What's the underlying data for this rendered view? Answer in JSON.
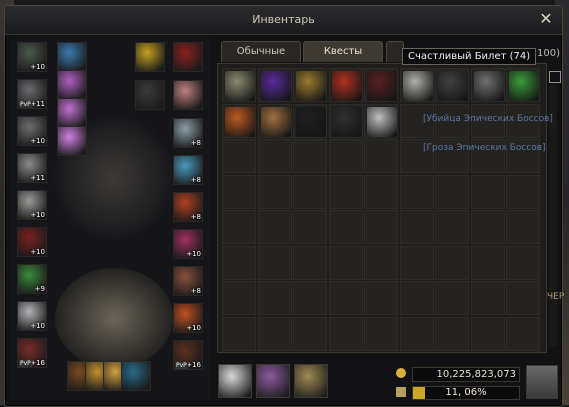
{
  "window": {
    "title": "Инвентарь",
    "close_glyph": "✕"
  },
  "tabs": [
    {
      "label": "Обычные",
      "active": false
    },
    {
      "label": "Квесты",
      "active": true
    }
  ],
  "tooltip": {
    "text": "Счастливый Билет (74)"
  },
  "capacity_partial": "100)",
  "background_texts": [
    "[Убийца Эпических Боссов]",
    "[Гроза Эпических Боссов]",
    "ЧЕР"
  ],
  "equipment_left": [
    {
      "name": "helmet",
      "enc": "+10",
      "color": "#4a5a4a"
    },
    {
      "name": "armor-top",
      "enc": "+11",
      "pvp": "PvP",
      "color": "#6a6a70"
    },
    {
      "name": "gloves",
      "enc": "+10",
      "color": "#6e6e72"
    },
    {
      "name": "legs",
      "enc": "+11",
      "color": "#8a8a88"
    },
    {
      "name": "boots",
      "enc": "+10",
      "color": "#9a9a96"
    },
    {
      "name": "cloak",
      "enc": "+10",
      "color": "#7a2020"
    },
    {
      "name": "shirt",
      "enc": "+9",
      "color": "#3a8a3a"
    },
    {
      "name": "ring-left",
      "enc": "+10",
      "color": "#b0b4b8"
    },
    {
      "name": "weapon",
      "enc": "+16",
      "pvp": "PvP",
      "color": "#7a2a2a"
    }
  ],
  "equipment_center": [
    {
      "name": "necklace",
      "color": "#3a7ab0"
    },
    {
      "name": "talisman-1",
      "color": "#b060c0"
    },
    {
      "name": "talisman-2",
      "color": "#c070d0"
    },
    {
      "name": "talisman-3",
      "color": "#d080e0"
    }
  ],
  "equipment_right": [
    {
      "name": "gold-item",
      "color": "#c8a020"
    },
    {
      "name": "hair-accessory",
      "color": "#8a2020"
    },
    {
      "name": "costume",
      "color": "#3a3a3a"
    },
    {
      "name": "gem",
      "color": "#c08080"
    },
    {
      "name": "sword",
      "enc": "+8",
      "color": "#8aa0a8"
    },
    {
      "name": "staff",
      "enc": "+8",
      "color": "#4a9ac0"
    },
    {
      "name": "amulet",
      "enc": "+8",
      "color": "#b04020"
    },
    {
      "name": "ring-right",
      "enc": "+10",
      "color": "#a03060"
    },
    {
      "name": "earring",
      "enc": "+8",
      "color": "#8a5040"
    },
    {
      "name": "pet-icon",
      "enc": "+10",
      "color": "#c05020"
    },
    {
      "name": "shield",
      "enc": "+16",
      "pvp": "PvP",
      "color": "#5a3020"
    }
  ],
  "bottom_slots": [
    {
      "name": "belt",
      "color": "#7a4a20"
    },
    {
      "name": "charm-1",
      "color": "#c09030"
    },
    {
      "name": "charm-2",
      "color": "#d0a040"
    },
    {
      "name": "bracelet",
      "color": "#2a6a8a"
    }
  ],
  "quest_items": [
    {
      "name": "scroll-map",
      "color": "#8a8a70"
    },
    {
      "name": "purple-crystal",
      "color": "#5a2a9a"
    },
    {
      "name": "gold-emblem",
      "color": "#9a7a30"
    },
    {
      "name": "red-orb",
      "color": "#b03020"
    },
    {
      "name": "dark-orb",
      "color": "#5a2020"
    },
    {
      "name": "lucky-ticket",
      "color": "#b0b0a8"
    },
    {
      "name": "pentagram-stone",
      "color": "#404040"
    },
    {
      "name": "dark-ticket",
      "color": "#707070"
    },
    {
      "name": "green-coin",
      "color": "#3a9a3a"
    },
    {
      "name": "orange-rod",
      "color": "#c05a20"
    },
    {
      "name": "old-scroll",
      "color": "#a07040"
    },
    {
      "name": "g-rune",
      "color": "#202020"
    },
    {
      "name": "dark-pouch",
      "color": "#303030"
    },
    {
      "name": "silver-coin",
      "color": "#c0c0c0"
    }
  ],
  "toolbar_buttons": [
    {
      "name": "dice-button",
      "color": "#d8d8d8"
    },
    {
      "name": "treasure-button",
      "color": "#8a5aa0"
    },
    {
      "name": "craft-button",
      "color": "#a08a50"
    }
  ],
  "adena": "10,225,823,073",
  "weight": {
    "text": "11, 06%",
    "percent": 11.06
  }
}
